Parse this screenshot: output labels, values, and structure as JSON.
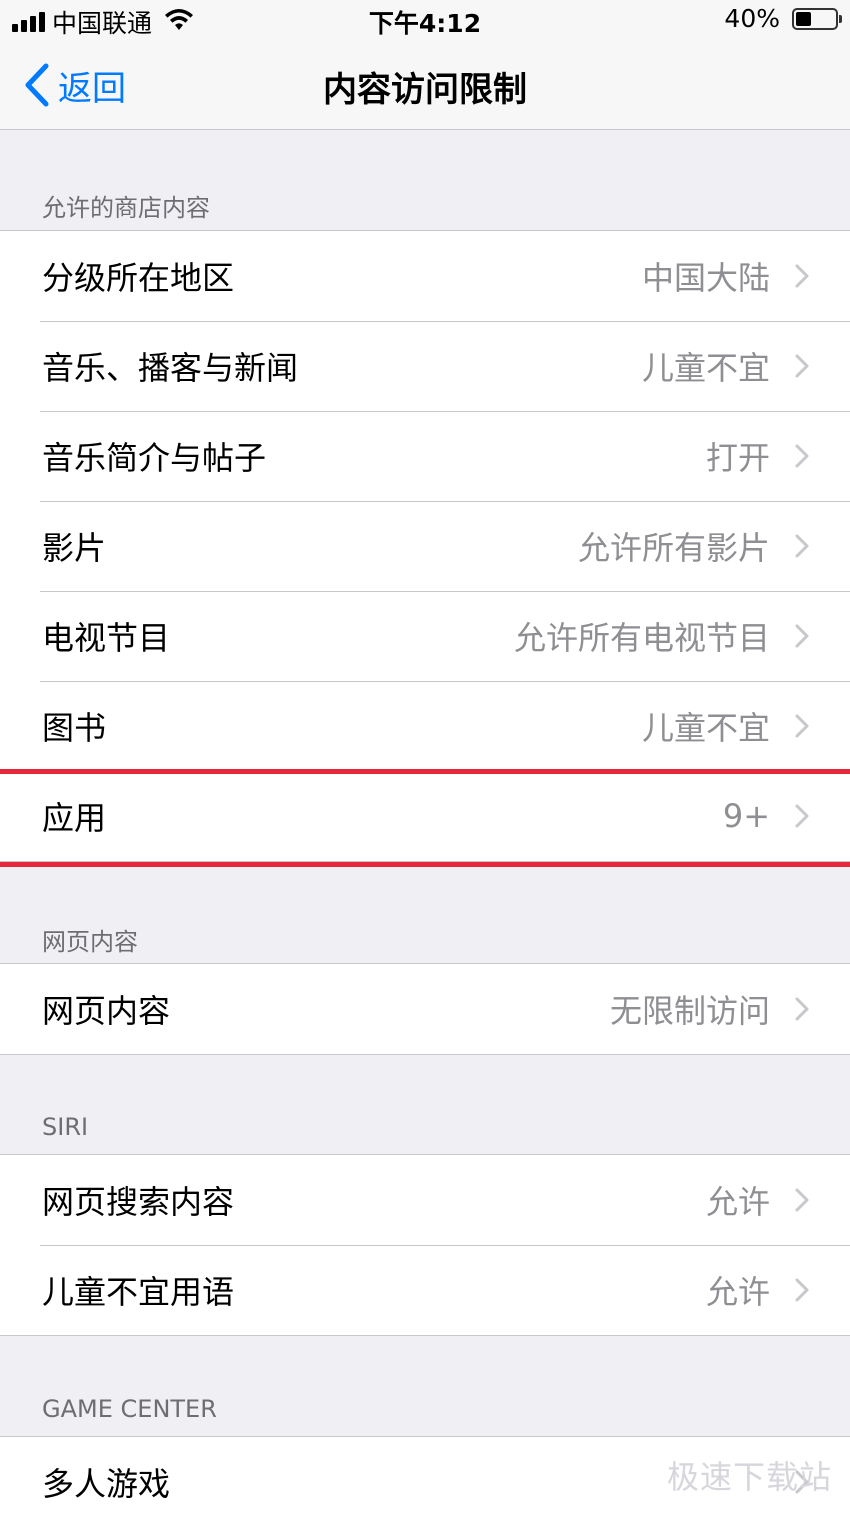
{
  "status_bar": {
    "carrier": "中国联通",
    "time": "下午4:12",
    "battery": "40%",
    "battery_level": 0.4
  },
  "nav": {
    "back_label": "返回",
    "title": "内容访问限制"
  },
  "sections": [
    {
      "header": "允许的商店内容",
      "rows": [
        {
          "label": "分级所在地区",
          "value": "中国大陆"
        },
        {
          "label": "音乐、播客与新闻",
          "value": "儿童不宜"
        },
        {
          "label": "音乐简介与帖子",
          "value": "打开"
        },
        {
          "label": "影片",
          "value": "允许所有影片"
        },
        {
          "label": "电视节目",
          "value": "允许所有电视节目"
        },
        {
          "label": "图书",
          "value": "儿童不宜"
        },
        {
          "label": "应用",
          "value": "9+"
        }
      ]
    },
    {
      "header": "网页内容",
      "rows": [
        {
          "label": "网页内容",
          "value": "无限制访问"
        }
      ]
    },
    {
      "header": "SIRI",
      "rows": [
        {
          "label": "网页搜索内容",
          "value": "允许"
        },
        {
          "label": "儿童不宜用语",
          "value": "允许"
        }
      ]
    },
    {
      "header": "GAME CENTER",
      "rows": [
        {
          "label": "多人游戏",
          "value": ""
        }
      ]
    }
  ],
  "watermark": "极速下载站",
  "colors": {
    "accent": "#007aff",
    "highlight": "#e5283a",
    "background": "#efeff4",
    "secondary_text": "#8e8e93"
  }
}
